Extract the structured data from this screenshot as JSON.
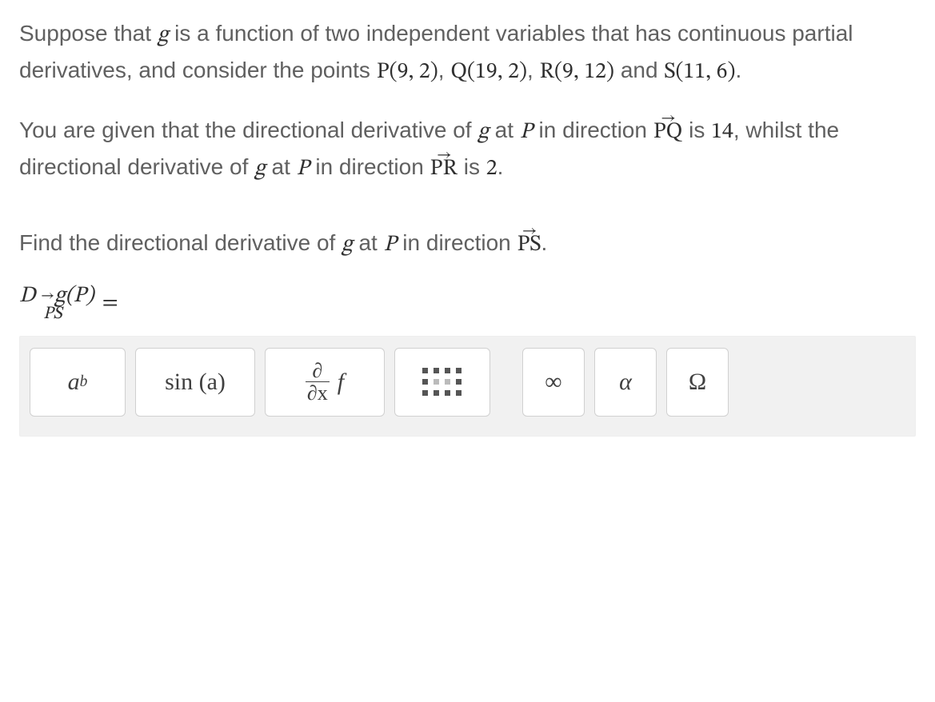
{
  "problem": {
    "sentence1_a": "Suppose that ",
    "g": "g",
    "sentence1_b": " is a function of two independent variables that has continuous partial derivatives, and consider the points ",
    "P": "P(9, 2)",
    "sep_comma": ", ",
    "Q": "Q(19, 2)",
    "R": "R(9, 12)",
    "and": " and ",
    "S": "S(11, 6)",
    "period": ".",
    "sentence2_a": "You are given that the directional derivative of ",
    "sentence2_b": " at ",
    "Pvar": "P",
    "sentence2_c": " in direction ",
    "PQ": "PQ",
    "sentence2_d": " is ",
    "val1": "14",
    "sentence2_e": ", whilst the directional derivative of ",
    "PR": "PR",
    "sentence2_f": " is ",
    "val2": "2",
    "sentence3_a": "Find the directional derivative of ",
    "PS": "PS"
  },
  "prompt": {
    "D": "D",
    "arrow": "→",
    "PS": "PS",
    "gP": "g(P)",
    "equals": "="
  },
  "toolbar": {
    "exp_base": "a",
    "exp_sup": "b",
    "sin": "sin (a)",
    "frac_num": "∂",
    "frac_den": "∂x",
    "frac_f": "f",
    "infinity": "∞",
    "alpha": "α",
    "omega": "Ω"
  }
}
